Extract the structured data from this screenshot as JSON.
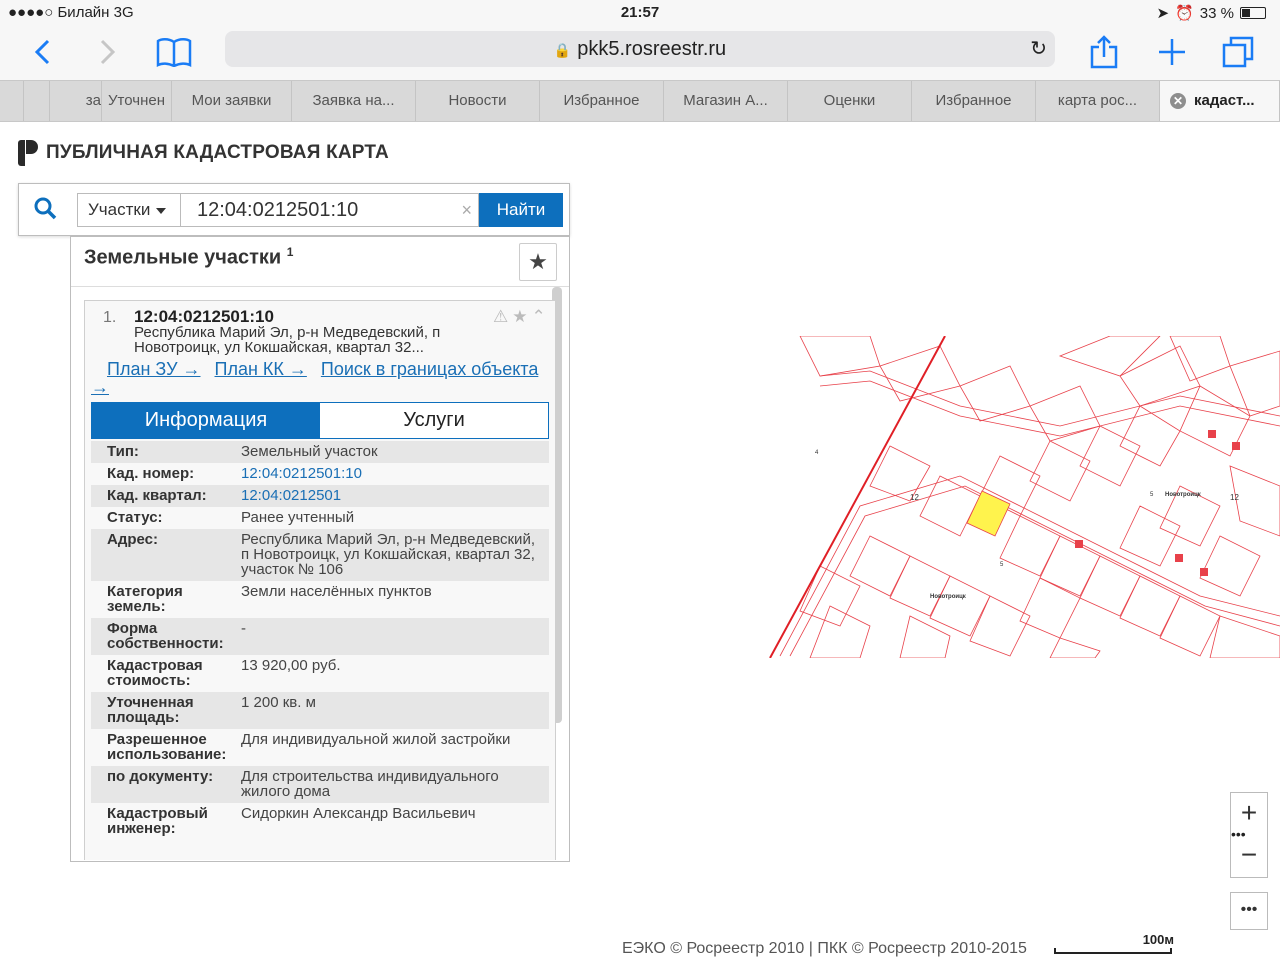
{
  "status": {
    "carrier": "●●●●○ Билайн  3G",
    "time": "21:57",
    "battery": "33 %"
  },
  "browser": {
    "url": "pkk5.rosreestr.ru",
    "tabs": [
      "за",
      "Уточнен",
      "Мои заявки",
      "Заявка на...",
      "Новости",
      "Избранное",
      "Магазин А...",
      "Оценки",
      "Избранное",
      "карта рос...",
      "кадаст..."
    ]
  },
  "page": {
    "title": "ПУБЛИЧНАЯ КАДАСТРОВАЯ КАРТА",
    "search": {
      "type": "Участки",
      "value": "12:04:0212501:10",
      "button": "Найти"
    },
    "panel": {
      "title": "Земельные участки",
      "count": "1"
    },
    "card": {
      "num": "1.",
      "id": "12:04:0212501:10",
      "address_short": "Республика Марий Эл, р-н Медведевский, п Новотроицк, ул Кокшайская, квартал 32...",
      "links": [
        "План ЗУ →",
        "План КК →",
        "Поиск в границах объекта →"
      ],
      "tab_info": "Информация",
      "tab_services": "Услуги",
      "rows": [
        {
          "k": "Тип:",
          "v": "Земельный участок"
        },
        {
          "k": "Кад. номер:",
          "v": "12:04:0212501:10"
        },
        {
          "k": "Кад. квартал:",
          "v": "12:04:0212501"
        },
        {
          "k": "Статус:",
          "v": "Ранее учтенный"
        },
        {
          "k": "Адрес:",
          "v": "Республика Марий Эл, р-н Медведевский, п Новотроицк, ул Кокшайская, квартал 32, участок № 106"
        },
        {
          "k": "Категория земель:",
          "v": "Земли населённых пунктов"
        },
        {
          "k": "Форма собственности:",
          "v": "-"
        },
        {
          "k": "Кадастровая стоимость:",
          "v": "13 920,00 руб."
        },
        {
          "k": "Уточненная площадь:",
          "v": "1 200 кв. м"
        },
        {
          "k": "Разрешенное использование:",
          "v": "Для индивидуальной жилой застройки"
        },
        {
          "k": "по документу:",
          "v": "Для строительства индивидуального жилого дома"
        },
        {
          "k": "Кадастровый инженер:",
          "v": "Сидоркин Александр Васильевич"
        }
      ]
    },
    "map": {
      "labels": [
        "12",
        "12",
        "Новотроицк",
        "Новотроицк",
        "5",
        "5",
        "4"
      ],
      "accent": "#e8414a",
      "highlight": "#fff34d"
    },
    "footer": "ЕЭКО © Росреестр 2010 | ПКК © Росреестр 2010-2015",
    "scale": "100м"
  }
}
